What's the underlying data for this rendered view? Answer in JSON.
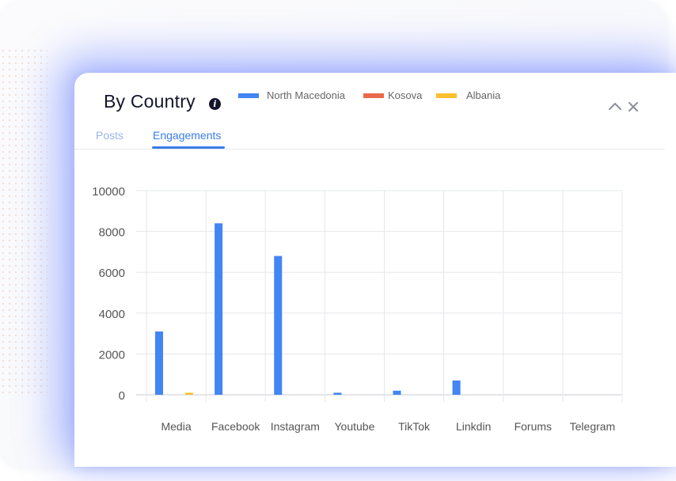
{
  "widget": {
    "title": "By Country",
    "info_icon": "info-icon",
    "collapse_icon": "chevron-up-icon",
    "close_icon": "close-icon"
  },
  "tabs": [
    {
      "label": "Posts",
      "active": false
    },
    {
      "label": "Engagements",
      "active": true
    }
  ],
  "colors": {
    "accent": "#3b7de8",
    "north_macedonia": "#4285f4",
    "kosova": "#ea6a4a",
    "albania": "#fbc02d"
  },
  "chart_data": {
    "type": "bar",
    "categories": [
      "Media",
      "Facebook",
      "Instagram",
      "Youtube",
      "TikTok",
      "Linkdin",
      "Forums",
      "Telegram"
    ],
    "series": [
      {
        "name": "North Macedonia",
        "values": [
          3100,
          8400,
          6800,
          100,
          200,
          700,
          0,
          0
        ]
      },
      {
        "name": "Kosova",
        "values": [
          0,
          0,
          0,
          0,
          0,
          0,
          0,
          0
        ]
      },
      {
        "name": "Albania",
        "values": [
          100,
          0,
          0,
          0,
          0,
          0,
          0,
          0
        ]
      }
    ],
    "y_ticks": [
      "0",
      "2000",
      "4000",
      "6000",
      "8000",
      "10000"
    ],
    "ylim": [
      0,
      10000
    ],
    "grid": true,
    "legend": "top-center"
  }
}
